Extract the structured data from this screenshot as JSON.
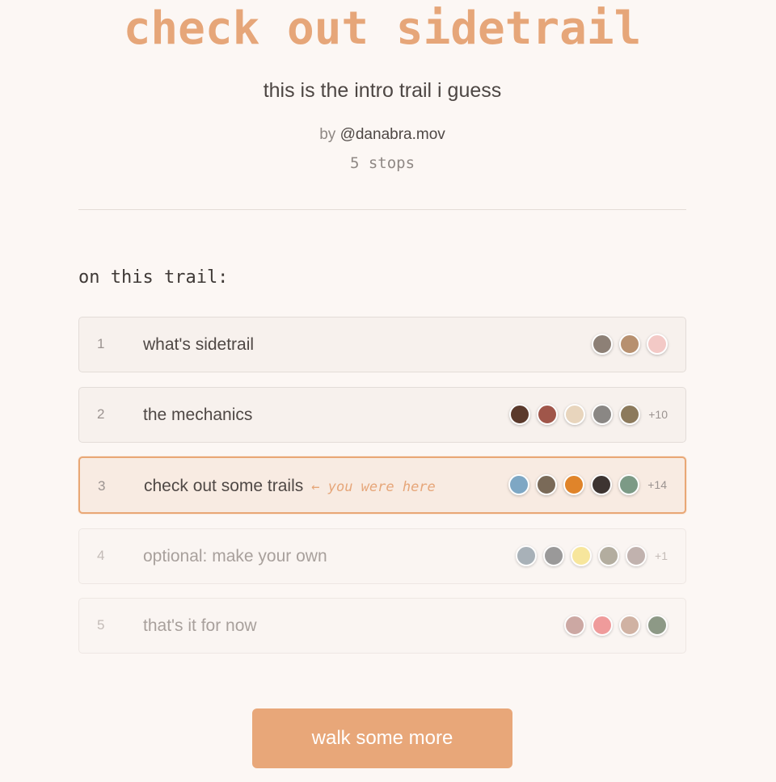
{
  "header": {
    "title": "check out sidetrail",
    "subtitle": "this is the intro trail i guess",
    "by_label": "by",
    "author": "@danabra.mov",
    "stops_count": "5 stops"
  },
  "section_label": "on this trail:",
  "stops": [
    {
      "number": "1",
      "title": "what's sidetrail",
      "avatar_colors": [
        "#8d8076",
        "#b7906f",
        "#f3c9c6"
      ],
      "more": ""
    },
    {
      "number": "2",
      "title": "the mechanics",
      "avatar_colors": [
        "#5b3a2c",
        "#a0564a",
        "#e8d5bd",
        "#8a8784",
        "#8c7a5c"
      ],
      "more": "+10"
    },
    {
      "number": "3",
      "title": "check out some trails",
      "you_were_here": "← you were here",
      "avatar_colors": [
        "#7ea7c4",
        "#7a6a58",
        "#e0842a",
        "#3d3431",
        "#7c9a86"
      ],
      "more": "+14"
    },
    {
      "number": "4",
      "title": "optional: make your own",
      "avatar_colors": [
        "#9aa6ae",
        "#8a8a8a",
        "#f7e48e",
        "#a7a191",
        "#b8a7a3"
      ],
      "more": "+1"
    },
    {
      "number": "5",
      "title": "that's it for now",
      "avatar_colors": [
        "#c59b96",
        "#ee8c8c",
        "#c9a796",
        "#7b8a74"
      ],
      "more": ""
    }
  ],
  "cta": {
    "label": "walk some more"
  },
  "colors": {
    "accent": "#e8a779",
    "background": "#fcf7f4"
  }
}
